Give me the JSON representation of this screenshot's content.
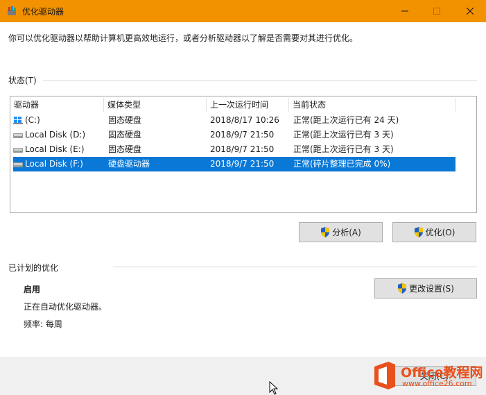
{
  "window": {
    "title": "优化驱动器",
    "minimize_icon": "minimize-icon",
    "maximize_icon": "maximize-icon",
    "close_icon": "close-icon",
    "accent_color": "#f39200"
  },
  "description": "你可以优化驱动器以帮助计算机更高效地运行，或者分析驱动器以了解是否需要对其进行优化。",
  "status": {
    "label": "状态(T)",
    "columns": [
      "驱动器",
      "媒体类型",
      "上一次运行时间",
      "当前状态"
    ],
    "rows": [
      {
        "drive": "(C:)",
        "media": "固态硬盘",
        "last_run": "2018/8/17 10:26",
        "status": "正常(距上次运行已有 24 天)",
        "icon": "windows-drive-icon",
        "selected": false
      },
      {
        "drive": "Local Disk (D:)",
        "media": "固态硬盘",
        "last_run": "2018/9/7 21:50",
        "status": "正常(距上次运行已有 3 天)",
        "icon": "drive-icon",
        "selected": false
      },
      {
        "drive": "Local Disk (E:)",
        "media": "固态硬盘",
        "last_run": "2018/9/7 21:50",
        "status": "正常(距上次运行已有 3 天)",
        "icon": "drive-icon",
        "selected": false
      },
      {
        "drive": "Local Disk (F:)",
        "media": "硬盘驱动器",
        "last_run": "2018/9/7 21:50",
        "status": "正常(碎片整理已完成 0%)",
        "icon": "drive-icon",
        "selected": true
      }
    ],
    "selection_color": "#0a78d7",
    "analyze_button": "分析(A)",
    "optimize_button": "优化(O)"
  },
  "scheduled": {
    "label": "已计划的优化",
    "state": "启用",
    "detail": "正在自动优化驱动器。",
    "frequency": "频率: 每周",
    "change_settings_button": "更改设置(S)"
  },
  "footer": {
    "close_button": "关闭(C)"
  },
  "watermark": {
    "brand": "Office教程网",
    "url": "www.office26.com"
  }
}
